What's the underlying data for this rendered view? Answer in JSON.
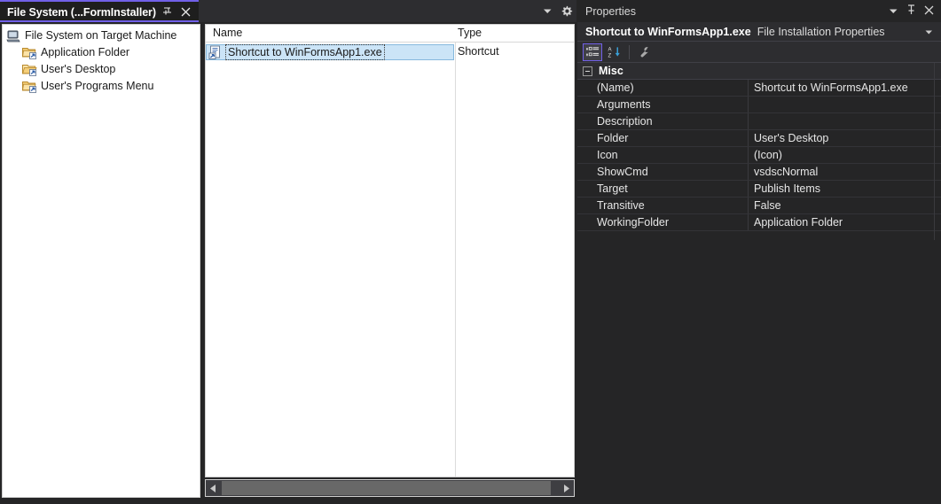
{
  "document_tab": {
    "title": "File System (...FormInstaller)",
    "pin_icon": "pin-icon",
    "close_icon": "close-icon"
  },
  "tabstrip": {
    "dropdown_icon": "chevron-down-icon",
    "settings_icon": "gear-icon"
  },
  "tree": {
    "items": [
      {
        "label": "File System on Target Machine",
        "icon": "computer-icon",
        "indent": 0
      },
      {
        "label": "Application Folder",
        "icon": "folder-shortcut-icon",
        "indent": 1
      },
      {
        "label": "User's Desktop",
        "icon": "folder-open-shortcut-icon",
        "indent": 1
      },
      {
        "label": "User's Programs Menu",
        "icon": "folder-shortcut-icon",
        "indent": 1
      }
    ]
  },
  "list": {
    "columns": [
      "Name",
      "Type"
    ],
    "rows": [
      {
        "name": "Shortcut to WinFormsApp1.exe",
        "type": "Shortcut",
        "icon": "shortcut-icon",
        "selected": true
      }
    ]
  },
  "scrollbar": {
    "left_arrow": "arrow-left-icon",
    "right_arrow": "arrow-right-icon"
  },
  "properties": {
    "title": "Properties",
    "title_dropdown_icon": "chevron-down-icon",
    "pin_icon": "pin-icon",
    "close_icon": "close-icon",
    "object_name": "Shortcut to WinFormsApp1.exe",
    "object_kind": "File Installation Properties",
    "object_chevron_icon": "chevron-down-icon",
    "toolbar": {
      "categorized_icon": "categorized-view-icon",
      "alphabetical_icon": "sort-alphabetical-icon",
      "property_pages_icon": "wrench-icon"
    },
    "category": "Misc",
    "rows": [
      {
        "key": "(Name)",
        "value": "Shortcut to WinFormsApp1.exe"
      },
      {
        "key": "Arguments",
        "value": ""
      },
      {
        "key": "Description",
        "value": ""
      },
      {
        "key": "Folder",
        "value": "User's Desktop"
      },
      {
        "key": "Icon",
        "value": "(Icon)"
      },
      {
        "key": "ShowCmd",
        "value": "vsdscNormal"
      },
      {
        "key": "Target",
        "value": "Publish Items"
      },
      {
        "key": "Transitive",
        "value": "False"
      },
      {
        "key": "WorkingFolder",
        "value": "Application Folder"
      }
    ]
  },
  "colors": {
    "accent": "#7160e8",
    "chrome_bg": "#2d2d30",
    "panel_bg": "#252526",
    "selection_blue": "#cbe4f7"
  }
}
